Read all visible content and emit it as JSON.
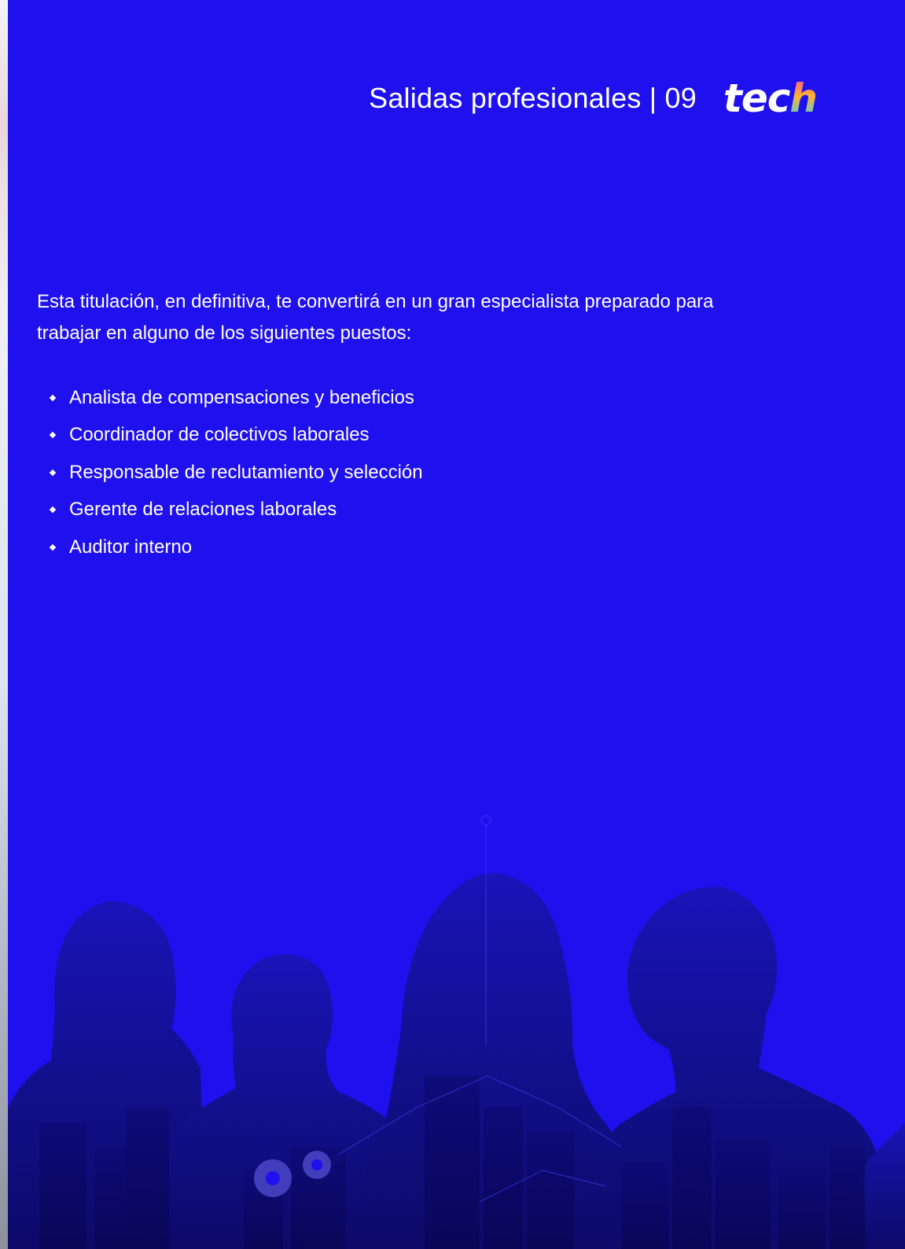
{
  "header": {
    "section_title": "Salidas profesionales | 09",
    "logo_main": "tec",
    "logo_last": "h"
  },
  "intro": {
    "text": "Esta titulación, en definitiva, te convertirá en un gran especialista preparado para trabajar en alguno de los siguientes puestos:"
  },
  "jobs": [
    "Analista de compensaciones y beneficios",
    "Coordinador de colectivos laborales",
    "Responsable de reclutamiento y selección",
    "Gerente de relaciones laborales",
    "Auditor interno"
  ],
  "colors": {
    "background": "#1f10ee",
    "text": "#ffffff",
    "silhouette": "#14109a"
  },
  "illustration": {
    "icon": "team-silhouette-cityscape-icon"
  }
}
